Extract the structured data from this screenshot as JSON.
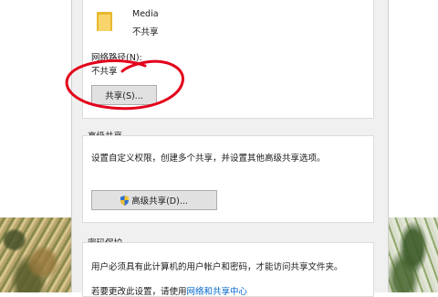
{
  "share_section": {
    "folder_name": "Media",
    "folder_status": "不共享",
    "network_path_label": "网络路径(N):",
    "network_path_value": "不共享",
    "share_button": "共享(S)..."
  },
  "advanced_section": {
    "title": "高级共享",
    "description": "设置自定义权限，创建多个共享，并设置其他高级共享选项。",
    "button": "高级共享(D)..."
  },
  "password_section": {
    "title": "密码保护",
    "description": "用户必须具有此计算机的用户帐户和密码，才能访问共享文件夹。",
    "footer_prefix": "若要更改此设置，请使用",
    "footer_link": "网络和共享中心"
  },
  "colors": {
    "annotation": "#e3001b",
    "link": "#0066cc"
  },
  "icons": {
    "folder": "folder-icon",
    "shield": "uac-shield-icon"
  }
}
